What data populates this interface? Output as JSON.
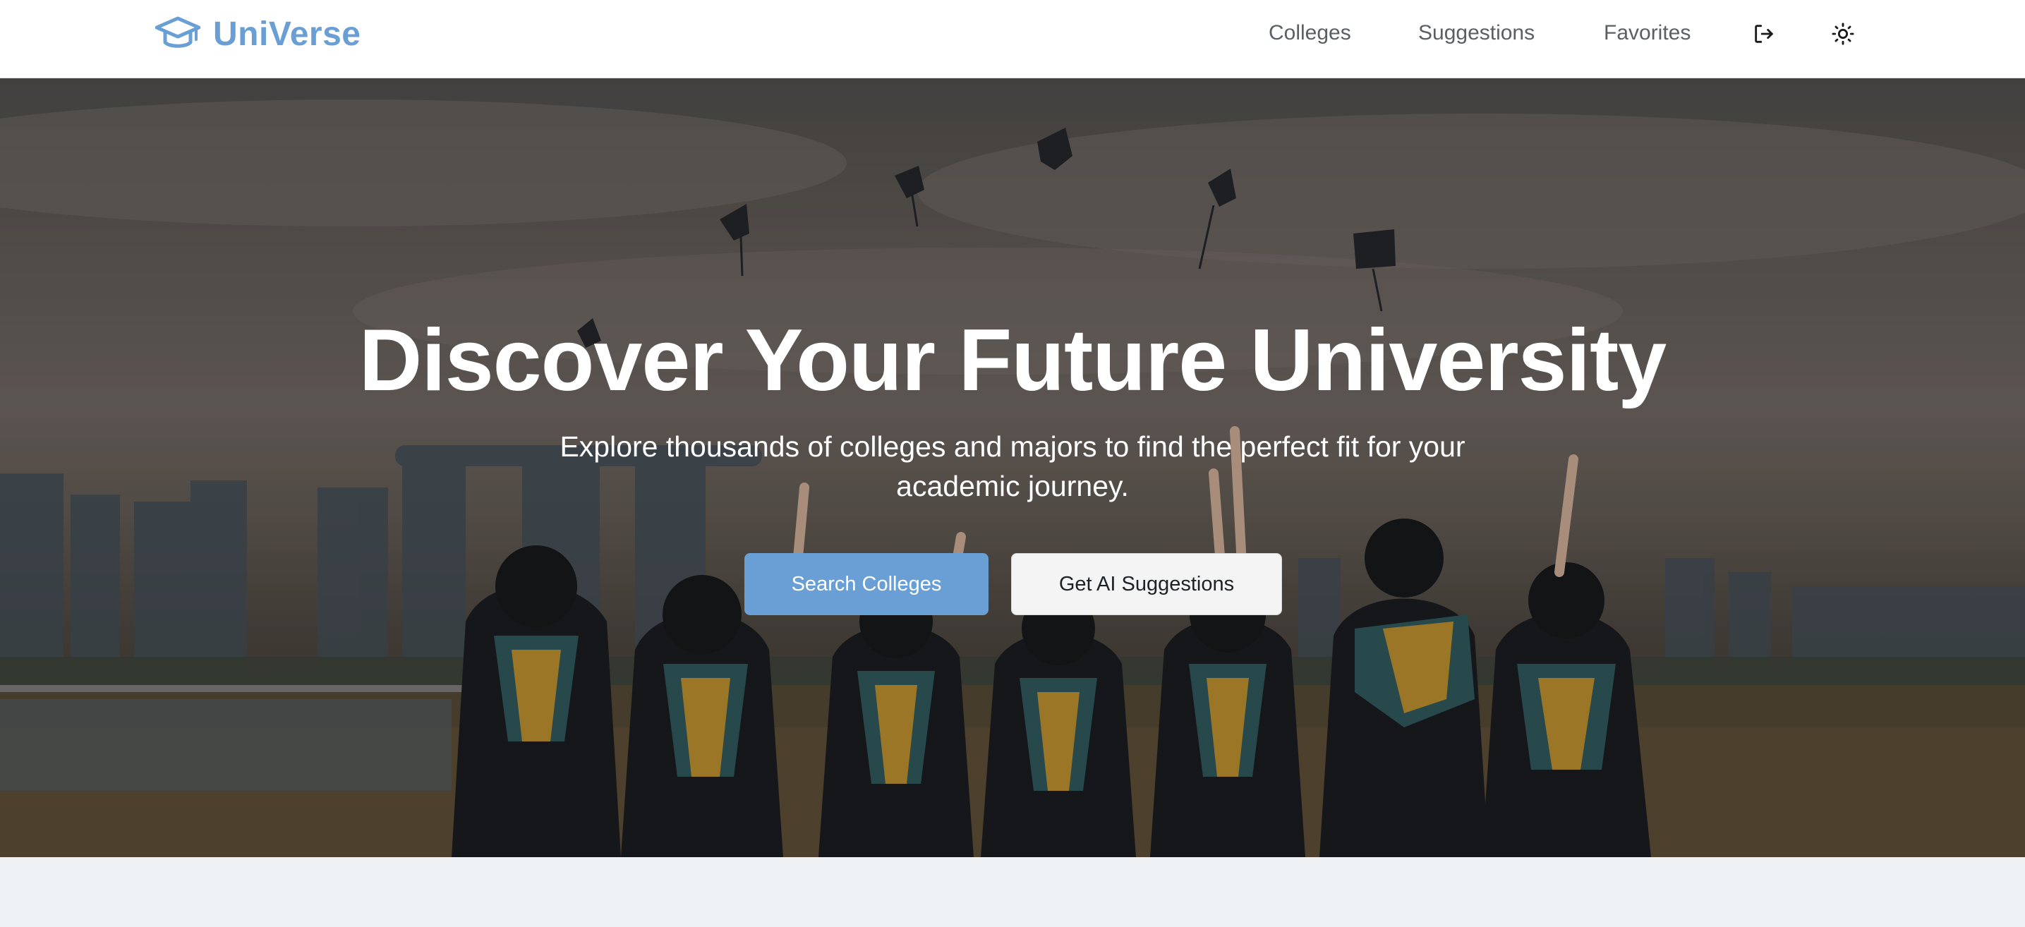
{
  "header": {
    "logo_text": "UniVerse",
    "logo_icon": "graduation-cap-icon",
    "nav": {
      "colleges": "Colleges",
      "suggestions": "Suggestions",
      "favorites": "Favorites"
    },
    "logout_icon": "logout-icon",
    "theme_icon": "sun-icon"
  },
  "hero": {
    "title": "Discover Your Future University",
    "subtitle": "Explore thousands of colleges and majors to find the perfect fit for your academic journey.",
    "primary_button": "Search Colleges",
    "secondary_button": "Get AI Suggestions",
    "background_image": "graduates-throwing-caps-photo"
  },
  "colors": {
    "brand": "#6a9fd6",
    "nav_text": "#5a5f66",
    "header_bg": "#ffffff",
    "page_bg": "#eef1f4",
    "secondary_button_bg": "#f4f4f4"
  }
}
